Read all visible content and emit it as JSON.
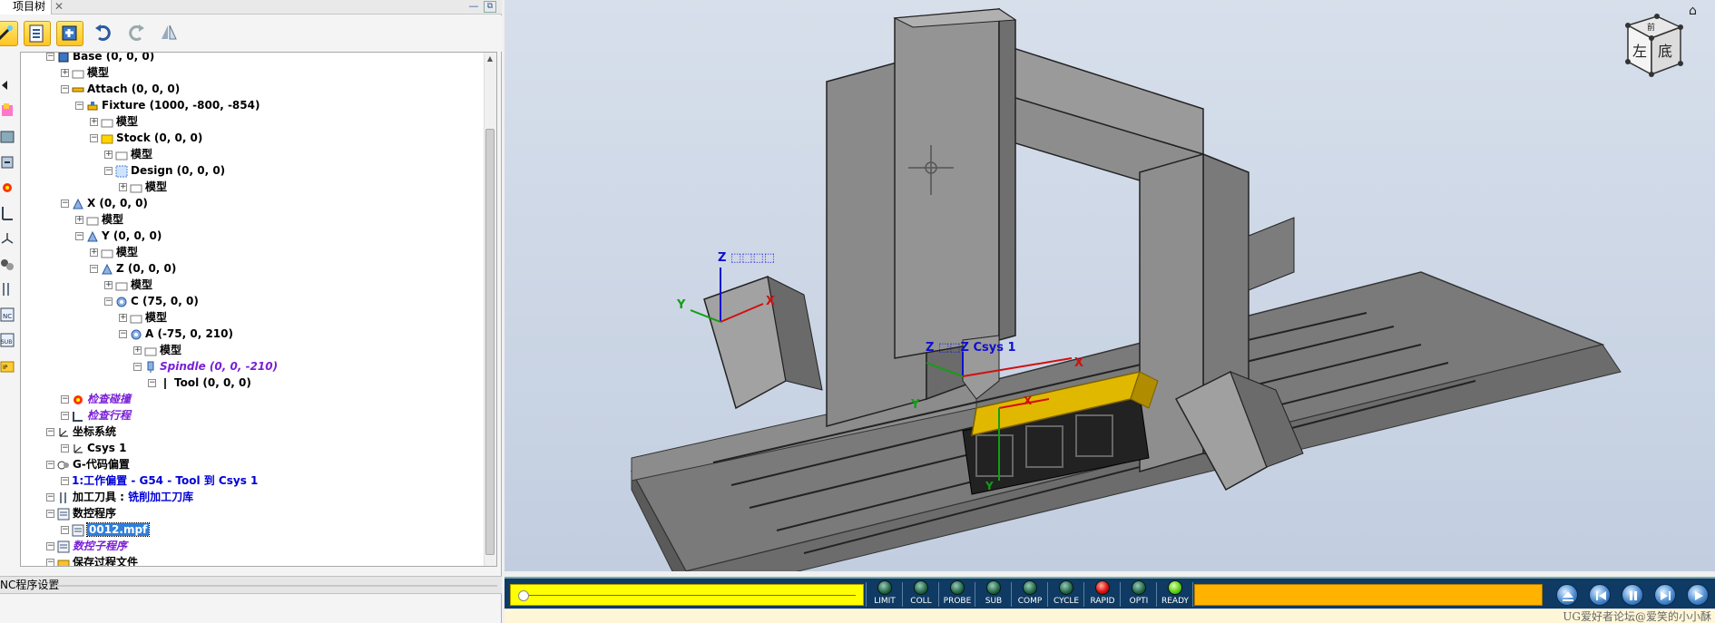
{
  "panel": {
    "tab_title": "项目树",
    "tab_close": "✕",
    "minimize": "—",
    "restore": "⧉"
  },
  "tree": [
    {
      "label": "Base (0, 0, 0)",
      "indent": 0,
      "style": "bold",
      "icon": "base-icon"
    },
    {
      "label": "模型",
      "indent": 1,
      "style": "bold",
      "icon": "model-icon"
    },
    {
      "label": "Attach (0, 0, 0)",
      "indent": 1,
      "style": "bold",
      "icon": "attach-icon"
    },
    {
      "label": "Fixture (1000, -800, -854)",
      "indent": 2,
      "style": "bold",
      "icon": "fixture-icon"
    },
    {
      "label": "模型",
      "indent": 3,
      "style": "bold",
      "icon": "model-icon"
    },
    {
      "label": "Stock (0, 0, 0)",
      "indent": 3,
      "style": "bold",
      "icon": "stock-icon"
    },
    {
      "label": "模型",
      "indent": 4,
      "style": "bold",
      "icon": "model-icon"
    },
    {
      "label": "Design (0, 0, 0)",
      "indent": 4,
      "style": "bold",
      "icon": "design-icon"
    },
    {
      "label": "模型",
      "indent": 5,
      "style": "bold",
      "icon": "model-icon"
    },
    {
      "label": "X (0, 0, 0)",
      "indent": 1,
      "style": "bold",
      "icon": "axis-icon"
    },
    {
      "label": "模型",
      "indent": 2,
      "style": "bold",
      "icon": "model-icon"
    },
    {
      "label": "Y (0, 0, 0)",
      "indent": 2,
      "style": "bold",
      "icon": "axis-icon"
    },
    {
      "label": "模型",
      "indent": 3,
      "style": "bold",
      "icon": "model-icon"
    },
    {
      "label": "Z (0, 0, 0)",
      "indent": 3,
      "style": "bold",
      "icon": "axis-icon"
    },
    {
      "label": "模型",
      "indent": 4,
      "style": "bold",
      "icon": "model-icon"
    },
    {
      "label": "C (75, 0, 0)",
      "indent": 4,
      "style": "bold",
      "icon": "rotary-icon"
    },
    {
      "label": "模型",
      "indent": 5,
      "style": "bold",
      "icon": "model-icon"
    },
    {
      "label": "A (-75, 0, 210)",
      "indent": 5,
      "style": "bold",
      "icon": "rotary-icon"
    },
    {
      "label": "模型",
      "indent": 6,
      "style": "bold",
      "icon": "model-icon"
    },
    {
      "label": "Spindle (0, 0, -210)",
      "indent": 6,
      "style": "purple",
      "icon": "spindle-icon"
    },
    {
      "label": "Tool (0, 0, 0)",
      "indent": 7,
      "style": "bold",
      "icon": "tool-icon"
    },
    {
      "label": "检查碰撞",
      "indent": 1,
      "style": "purple",
      "icon": "collision-icon"
    },
    {
      "label": "检查行程",
      "indent": 1,
      "style": "purple",
      "icon": "travel-icon"
    },
    {
      "label": "坐标系统",
      "indent": 0,
      "style": "bold",
      "icon": "csys-icon"
    },
    {
      "label": "Csys 1",
      "indent": 1,
      "style": "bold",
      "icon": "csys-icon"
    },
    {
      "label": "G-代码偏置",
      "indent": 0,
      "style": "bold",
      "icon": "offset-icon"
    },
    {
      "label": "1:工作偏置 - G54 - Tool 到 Csys 1",
      "indent": 1,
      "style": "blue",
      "icon": ""
    },
    {
      "label": "加工刀具 : ",
      "label2": "铣削加工刀库",
      "indent": 0,
      "style": "bold",
      "icon": "tooling-icon"
    },
    {
      "label": "数控程序",
      "indent": 0,
      "style": "bold",
      "icon": "nc-program-icon"
    },
    {
      "label": "0012.mpf",
      "indent": 1,
      "style": "selected",
      "icon": "nc-file-icon"
    },
    {
      "label": "数控子程序",
      "indent": 0,
      "style": "purple",
      "icon": "subprogram-icon"
    },
    {
      "label": "保存过程文件",
      "indent": 0,
      "style": "bold",
      "icon": "save-folder-icon"
    }
  ],
  "bottom_tab": "NC程序设置",
  "viewport": {
    "label_z_top": "Z 坐标系统",
    "label_z_top_short": "Z ⬚⬚⬚⬚",
    "label_x": "X",
    "label_y": "Y",
    "label_csys": "Z ⬚⬚Z Csys 1",
    "label_x2": "X",
    "label_y2": "Y",
    "label_x3": "X",
    "label_y3": "Y",
    "cube_top": "前",
    "cube_left": "左",
    "cube_right": "底",
    "home": "⌂"
  },
  "controls": {
    "lamps": [
      {
        "label": "LIMIT",
        "state": "off"
      },
      {
        "label": "COLL",
        "state": "off"
      },
      {
        "label": "PROBE",
        "state": "off"
      },
      {
        "label": "SUB",
        "state": "off"
      },
      {
        "label": "COMP",
        "state": "off"
      },
      {
        "label": "CYCLE",
        "state": "off"
      },
      {
        "label": "RAPID",
        "state": "red"
      },
      {
        "label": "OPTI",
        "state": "off"
      },
      {
        "label": "READY",
        "state": "green"
      }
    ],
    "scrub_position": 0.0
  },
  "watermark": "UG爱好者论坛@爱笑的小小酥",
  "colors": {
    "accent_blue": "#0000d8",
    "purple": "#7a1fd6",
    "scrub_yellow": "#ffff00",
    "progress_orange": "#ffb300",
    "control_bg": "#0e3a63"
  }
}
